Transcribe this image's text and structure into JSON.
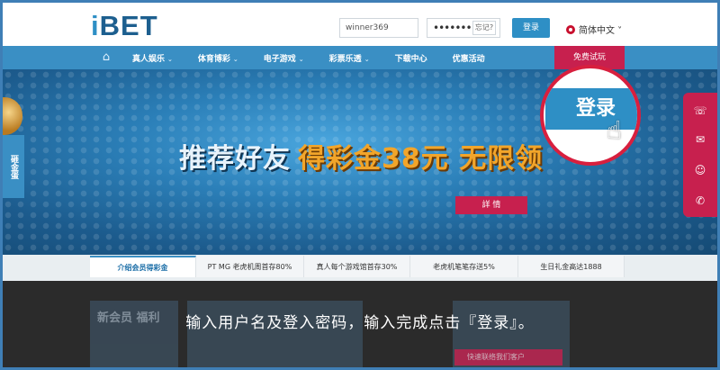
{
  "header": {
    "logo_i": "i",
    "logo_bet": "BET",
    "username_value": "winner369",
    "password_value": "•••••••••",
    "forgot_label": "忘记?",
    "login_label": "登录",
    "language_label": "简体中文 ˅"
  },
  "nav": {
    "items": [
      {
        "label": "真人娱乐"
      },
      {
        "label": "体育博彩"
      },
      {
        "label": "电子游戏"
      },
      {
        "label": "彩票乐透"
      },
      {
        "label": "下载中心"
      },
      {
        "label": "优惠活动"
      }
    ],
    "promo_label": "免费试玩"
  },
  "banner": {
    "title_part1": "推荐好友",
    "title_part2": "得彩金38元 无限领",
    "detail_label": "詳 情",
    "left_tab_label": "砸金蛋"
  },
  "callout": {
    "label": "登录"
  },
  "tabs": [
    {
      "label": "介绍会员得彩金"
    },
    {
      "label": "PT MG 老虎机周首存80%"
    },
    {
      "label": "真人每个游戏馆首存30%"
    },
    {
      "label": "老虎机笔笔存送5%"
    },
    {
      "label": "生日礼金高达1888"
    }
  ],
  "bottom": {
    "card1_text": "新会员 福利",
    "caption": "输入用户名及登入密码，输入完成点击『登录』。",
    "pill_text": "快速联络我们客户"
  },
  "colors": {
    "brand_blue": "#2e8fc5",
    "accent_red": "#c7204e",
    "nav_blue": "#3a8fc4"
  }
}
